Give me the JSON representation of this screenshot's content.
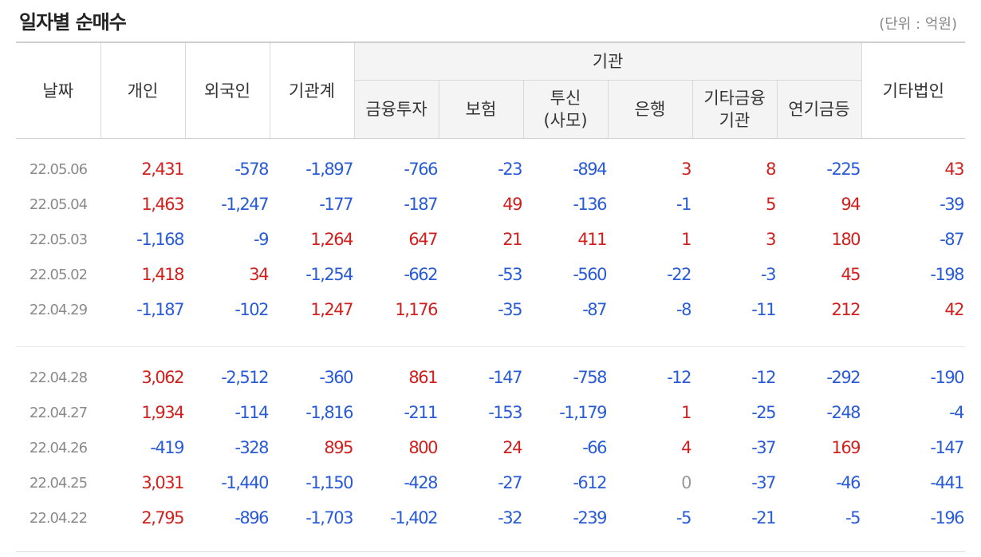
{
  "header": {
    "title": "일자별 순매수",
    "unit": "(단위 : 억원)"
  },
  "columns": {
    "date": "날짜",
    "individual": "개인",
    "foreign": "외국인",
    "institution_total": "기관계",
    "institution_group": "기관",
    "financial_investment": "금융투자",
    "insurance": "보험",
    "trust_line1": "투신",
    "trust_line2": "(사모)",
    "bank": "은행",
    "other_finance_line1": "기타금융",
    "other_finance_line2": "기관",
    "pension": "연기금등",
    "other_corp": "기타법인"
  },
  "colors": {
    "positive": "#d0211f",
    "negative": "#2a5bd7",
    "zero": "#999999"
  },
  "rows": [
    [
      "22.05.06",
      "2,431",
      "-578",
      "-1,897",
      "-766",
      "-23",
      "-894",
      "3",
      "8",
      "-225",
      "43"
    ],
    [
      "22.05.04",
      "1,463",
      "-1,247",
      "-177",
      "-187",
      "49",
      "-136",
      "-1",
      "5",
      "94",
      "-39"
    ],
    [
      "22.05.03",
      "-1,168",
      "-9",
      "1,264",
      "647",
      "21",
      "411",
      "1",
      "3",
      "180",
      "-87"
    ],
    [
      "22.05.02",
      "1,418",
      "34",
      "-1,254",
      "-662",
      "-53",
      "-560",
      "-22",
      "-3",
      "45",
      "-198"
    ],
    [
      "22.04.29",
      "-1,187",
      "-102",
      "1,247",
      "1,176",
      "-35",
      "-87",
      "-8",
      "-11",
      "212",
      "42"
    ],
    [
      "22.04.28",
      "3,062",
      "-2,512",
      "-360",
      "861",
      "-147",
      "-758",
      "-12",
      "-12",
      "-292",
      "-190"
    ],
    [
      "22.04.27",
      "1,934",
      "-114",
      "-1,816",
      "-211",
      "-153",
      "-1,179",
      "1",
      "-25",
      "-248",
      "-4"
    ],
    [
      "22.04.26",
      "-419",
      "-328",
      "895",
      "800",
      "24",
      "-66",
      "4",
      "-37",
      "169",
      "-147"
    ],
    [
      "22.04.25",
      "3,031",
      "-1,440",
      "-1,150",
      "-428",
      "-27",
      "-612",
      "0",
      "-37",
      "-46",
      "-441"
    ],
    [
      "22.04.22",
      "2,795",
      "-896",
      "-1,703",
      "-1,402",
      "-32",
      "-239",
      "-5",
      "-21",
      "-5",
      "-196"
    ]
  ]
}
